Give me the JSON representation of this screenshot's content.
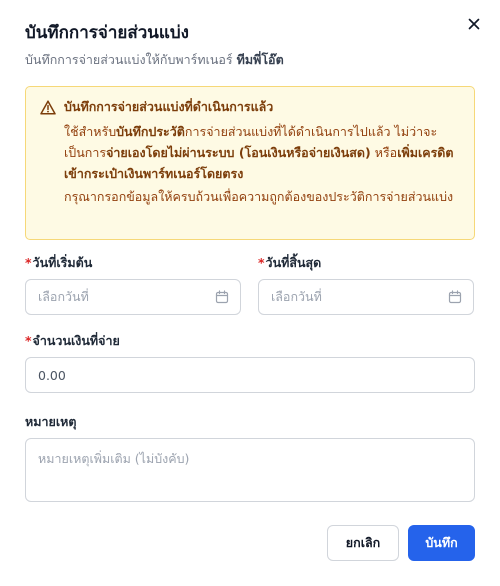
{
  "dialog": {
    "title": "บันทึกการจ่ายส่วนแบ่ง",
    "subtitle_prefix": "บันทึกการจ่ายส่วนแบ่งให้กับพาร์ทเนอร์ ",
    "partner_name": "ทีมพี่โอ๊ต",
    "close_icon": "close-icon"
  },
  "alert": {
    "icon": "warning-triangle-icon",
    "title": "บันทึกการจ่ายส่วนแบ่งที่ดำเนินการแล้ว",
    "text_1": "ใช้สำหรับ",
    "text_bold_1": "บันทึกประวัติ",
    "text_2": "การจ่ายส่วนแบ่งที่ได้ดำเนินการไปแล้ว ไม่ว่าจะเป็นการ",
    "text_bold_2": "จ่ายเองโดยไม่ผ่านระบบ (โอนเงินหรือจ่ายเงินสด)",
    "text_3": " หรือ",
    "text_bold_3": "เพิ่มเครดิตเข้ากระเป๋าเงินพาร์ทเนอร์โดยตรง",
    "note": "กรุณากรอกข้อมูลให้ครบถ้วนเพื่อความถูกต้องของประวัติการจ่ายส่วนแบ่ง"
  },
  "form": {
    "required_mark": "*",
    "start_date": {
      "label": "วันที่เริ่มต้น",
      "placeholder": "เลือกวันที่",
      "icon": "calendar-icon"
    },
    "end_date": {
      "label": "วันที่สิ้นสุด",
      "placeholder": "เลือกวันที่",
      "icon": "calendar-icon"
    },
    "amount": {
      "label": "จำนวนเงินที่จ่าย",
      "value": "0.00"
    },
    "note": {
      "label": "หมายเหตุ",
      "placeholder": "หมายเหตุเพิ่มเติม (ไม่บังคับ)"
    }
  },
  "footer": {
    "cancel_label": "ยกเลิก",
    "save_label": "บันทึก"
  },
  "colors": {
    "primary": "#2563eb",
    "required": "#dc2626",
    "alert_border": "#f6d878",
    "alert_bg": "#fefae4",
    "alert_text": "#92400e"
  }
}
